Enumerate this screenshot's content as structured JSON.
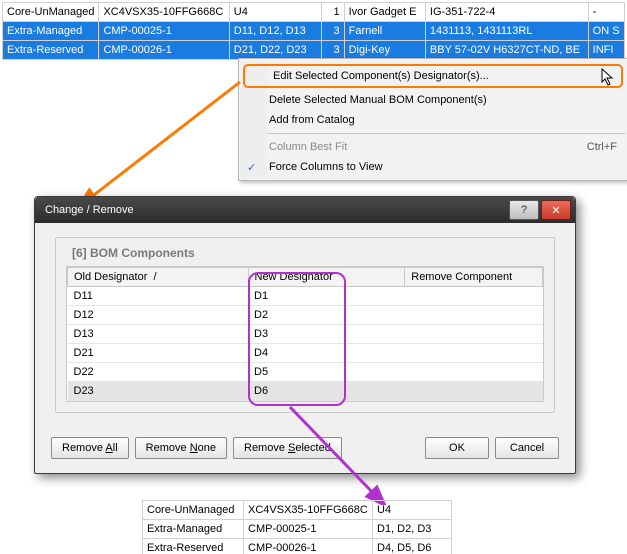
{
  "top_rows": [
    {
      "c1": "Core-UnManaged",
      "c2": "XC4VSX35-10FFG668C",
      "c3": "U4",
      "c4": "1",
      "c5": "Ivor Gadget E",
      "c6": "IG-351-722-4",
      "c7": "-",
      "sel": false
    },
    {
      "c1": "Extra-Managed",
      "c2": "CMP-00025-1",
      "c3": "D11, D12, D13",
      "c4": "3",
      "c5": "Farnell",
      "c6": "1431113, 1431113RL",
      "c7": "ON S",
      "sel": true
    },
    {
      "c1": "Extra-Reserved",
      "c2": "CMP-00026-1",
      "c3": "D21, D22, D23",
      "c4": "3",
      "c5": "Digi-Key",
      "c6": "BBY 57-02V H6327CT-ND, BE",
      "c7": "INFI",
      "sel": true
    }
  ],
  "ctx": {
    "edit": "Edit Selected Component(s) Designator(s)...",
    "delete": "Delete Selected Manual BOM Component(s)",
    "add": "Add from Catalog",
    "bestfit": "Column Best Fit",
    "bestfit_kbd": "Ctrl+F",
    "force": "Force Columns to View"
  },
  "dialog": {
    "title": "Change / Remove",
    "group_title": "[6] BOM Components",
    "cols": {
      "old": "Old Designator",
      "new": "New Designator",
      "rem": "Remove Component"
    },
    "rows": [
      {
        "old": "D11",
        "new": "D1"
      },
      {
        "old": "D12",
        "new": "D2"
      },
      {
        "old": "D13",
        "new": "D3"
      },
      {
        "old": "D21",
        "new": "D4"
      },
      {
        "old": "D22",
        "new": "D5"
      },
      {
        "old": "D23",
        "new": "D6"
      }
    ],
    "btn_remove_all": "Remove All",
    "btn_remove_none": "Remove None",
    "btn_remove_selected": "Remove Selected",
    "btn_ok": "OK",
    "btn_cancel": "Cancel"
  },
  "result_rows": [
    {
      "r1": "Core-UnManaged",
      "r2": "XC4VSX35-10FFG668C",
      "r3": "U4"
    },
    {
      "r1": "Extra-Managed",
      "r2": "CMP-00025-1",
      "r3": "D1, D2, D3"
    },
    {
      "r1": "Extra-Reserved",
      "r2": "CMP-00026-1",
      "r3": "D4, D5, D6"
    }
  ]
}
